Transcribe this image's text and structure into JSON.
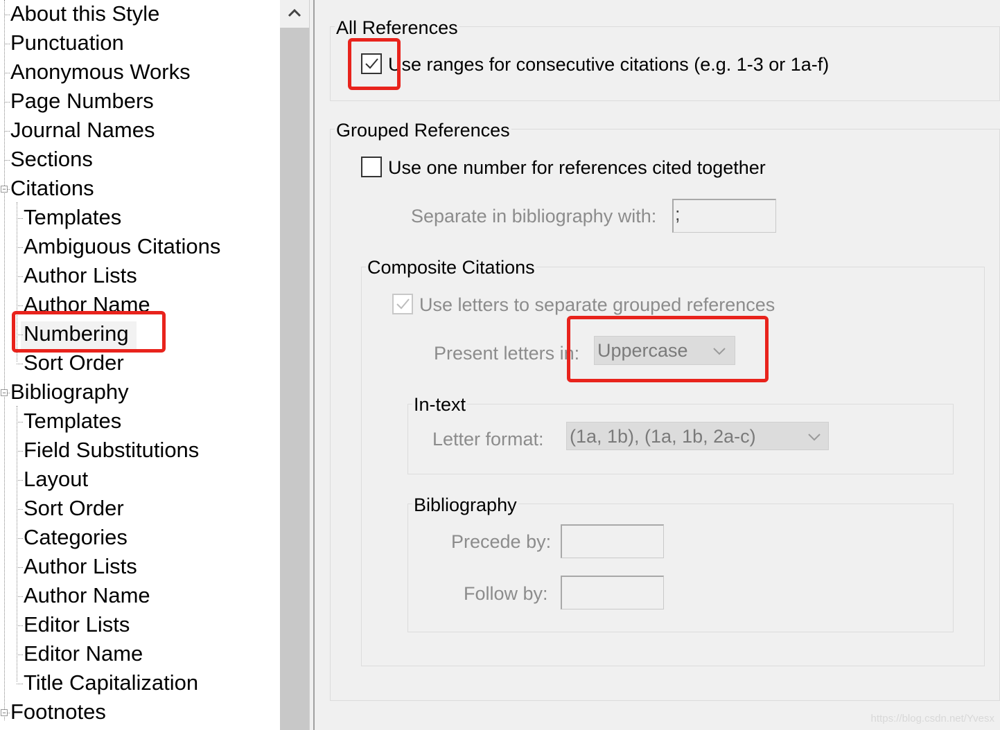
{
  "tree": {
    "items": [
      {
        "label": "About this Style",
        "level": 0
      },
      {
        "label": "Punctuation",
        "level": 0
      },
      {
        "label": "Anonymous Works",
        "level": 0
      },
      {
        "label": "Page Numbers",
        "level": 0
      },
      {
        "label": "Journal Names",
        "level": 0
      },
      {
        "label": "Sections",
        "level": 0
      },
      {
        "label": "Citations",
        "level": 0
      },
      {
        "label": "Templates",
        "level": 1
      },
      {
        "label": "Ambiguous Citations",
        "level": 1
      },
      {
        "label": "Author Lists",
        "level": 1
      },
      {
        "label": "Author Name",
        "level": 1
      },
      {
        "label": "Numbering",
        "level": 1
      },
      {
        "label": "Sort Order",
        "level": 1
      },
      {
        "label": "Bibliography",
        "level": 0
      },
      {
        "label": "Templates",
        "level": 1
      },
      {
        "label": "Field Substitutions",
        "level": 1
      },
      {
        "label": "Layout",
        "level": 1
      },
      {
        "label": "Sort Order",
        "level": 1
      },
      {
        "label": "Categories",
        "level": 1
      },
      {
        "label": "Author Lists",
        "level": 1
      },
      {
        "label": "Author Name",
        "level": 1
      },
      {
        "label": "Editor Lists",
        "level": 1
      },
      {
        "label": "Editor Name",
        "level": 1
      },
      {
        "label": "Title Capitalization",
        "level": 1
      },
      {
        "label": "Footnotes",
        "level": 0
      }
    ],
    "selected": "Numbering"
  },
  "all_references": {
    "title": "All References",
    "use_ranges": {
      "label": "Use ranges for consecutive citations (e.g. 1-3 or 1a-f)",
      "checked": true
    }
  },
  "grouped_references": {
    "title": "Grouped References",
    "use_one_number": {
      "label": "Use one number for references cited together",
      "checked": false
    },
    "separate_label": "Separate in bibliography with:",
    "separate_value": ";"
  },
  "composite_citations": {
    "title": "Composite Citations",
    "use_letters": {
      "label": "Use letters to separate grouped references",
      "checked": true,
      "enabled": false
    },
    "present_letters_label": "Present letters in:",
    "present_letters_value": "Uppercase",
    "in_text": {
      "title": "In-text",
      "letter_format_label": "Letter format:",
      "letter_format_value": "(1a, 1b), (1a, 1b, 2a-c)"
    },
    "bibliography": {
      "title": "Bibliography",
      "precede_label": "Precede by:",
      "precede_value": "",
      "follow_label": "Follow by:",
      "follow_value": ""
    }
  },
  "watermark": "https://blog.csdn.net/Yvesx",
  "colors": {
    "highlight": "#e8231c",
    "disabled_text": "#8c8c8c"
  },
  "icons": {
    "scroll_up": "chevron-up-icon",
    "check": "checkmark-icon",
    "dropdown": "chevron-down-icon"
  }
}
